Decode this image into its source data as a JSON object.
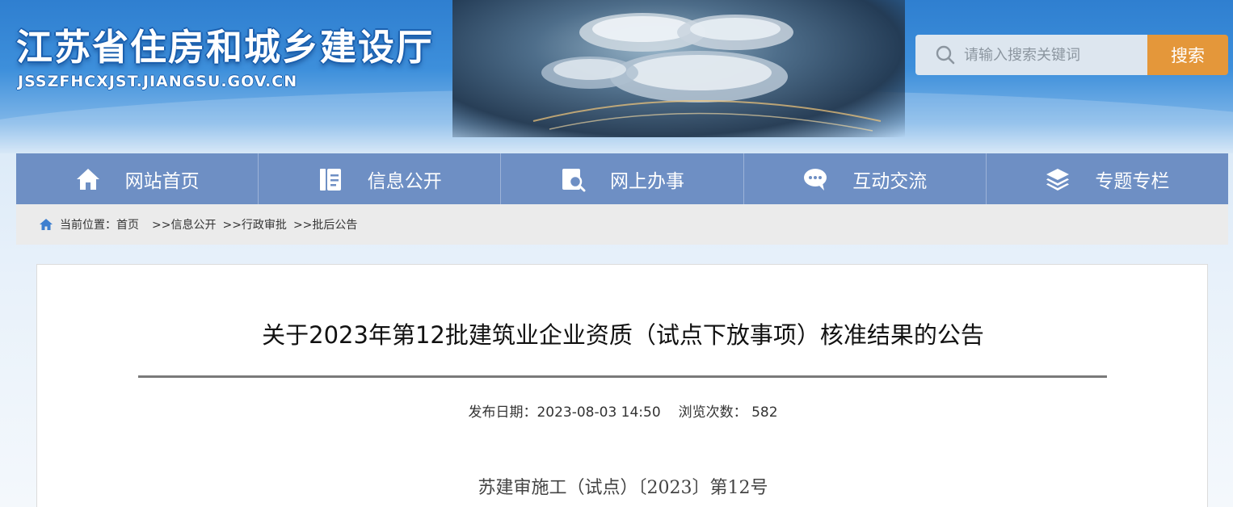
{
  "header": {
    "site_title": "江苏省住房和城乡建设厅",
    "site_domain": "JSSZFHCXJST.JIANGSU.GOV.CN"
  },
  "search": {
    "placeholder": "请输入搜索关键词",
    "value": "",
    "button_label": "搜索",
    "button_color": "#e4973a"
  },
  "nav": {
    "background": "#6e8fc4",
    "items": [
      {
        "label": "网站首页",
        "icon": "home-icon"
      },
      {
        "label": "信息公开",
        "icon": "document-icon"
      },
      {
        "label": "网上办事",
        "icon": "search-document-icon"
      },
      {
        "label": "互动交流",
        "icon": "chat-icon"
      },
      {
        "label": "专题专栏",
        "icon": "layers-icon"
      }
    ]
  },
  "breadcrumb": {
    "prefix": "当前位置：",
    "items": [
      "首页",
      ">>信息公开",
      ">>行政审批",
      ">>批后公告"
    ]
  },
  "article": {
    "title": "关于2023年第12批建筑业企业资质（试点下放事项）核准结果的公告",
    "publish_label": "发布日期：",
    "publish_date": "2023-08-03 14:50",
    "views_label": "浏览次数：",
    "views": "582",
    "doc_number": "苏建审施工（试点）〔2023〕第12号"
  }
}
